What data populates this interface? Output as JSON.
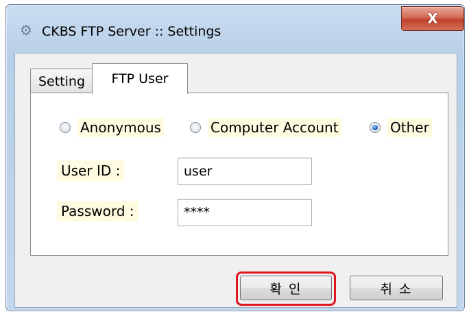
{
  "window": {
    "title": "CKBS FTP Server :: Settings",
    "icon": "gear-icon",
    "close_label": "X"
  },
  "tabs": [
    {
      "label": "Setting",
      "active": false
    },
    {
      "label": "FTP User",
      "active": true
    }
  ],
  "auth": {
    "options": [
      {
        "label": "Anonymous",
        "checked": false
      },
      {
        "label": "Computer Account",
        "checked": false
      },
      {
        "label": "Other",
        "checked": true
      }
    ]
  },
  "fields": {
    "user_id_label": "User ID :",
    "user_id_value": "user",
    "password_label": "Password :",
    "password_value": "****"
  },
  "buttons": {
    "ok_label": "확 인",
    "cancel_label": "취 소"
  },
  "colors": {
    "highlight": "#e0141d",
    "label_background": "#fffbe0"
  }
}
